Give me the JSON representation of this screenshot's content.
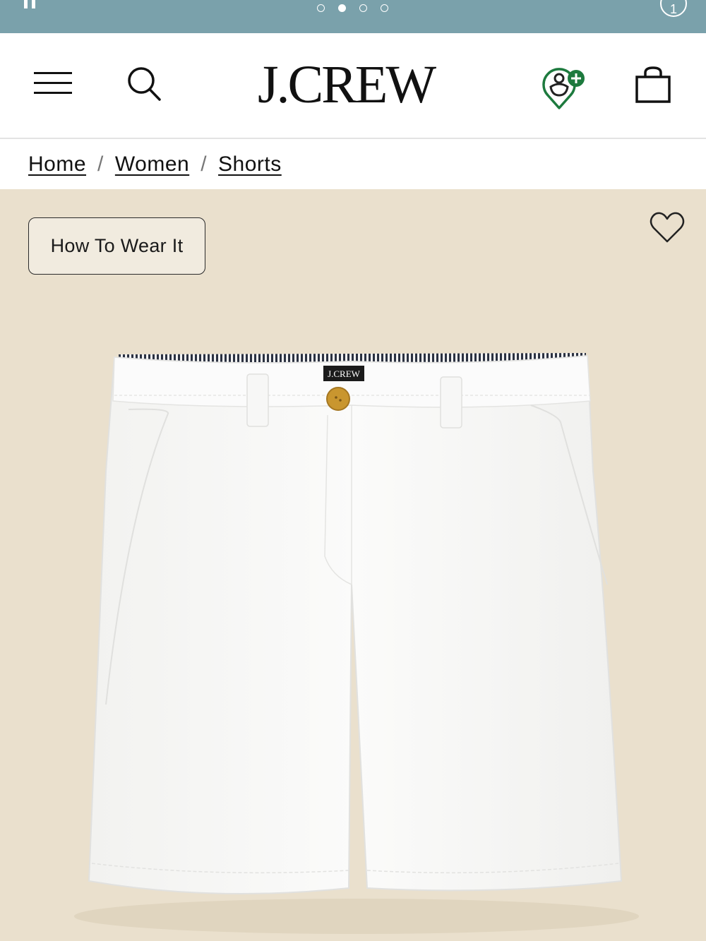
{
  "promo": {
    "dots": [
      false,
      true,
      false,
      false
    ],
    "info_label": "1"
  },
  "header": {
    "logo": "J.CREW",
    "menu_icon": "hamburger-menu-icon",
    "search_icon": "search-icon",
    "rewards_icon": "rewards-user-plus-icon",
    "bag_icon": "shopping-bag-icon",
    "rewards_badge_color": "#1d7a3e"
  },
  "breadcrumb": {
    "items": [
      "Home",
      "Women",
      "Shorts"
    ],
    "separator": "/"
  },
  "product": {
    "how_to_wear_label": "How To Wear It",
    "waistband_tag": "J.CREW",
    "background_color": "#eae0cd"
  }
}
